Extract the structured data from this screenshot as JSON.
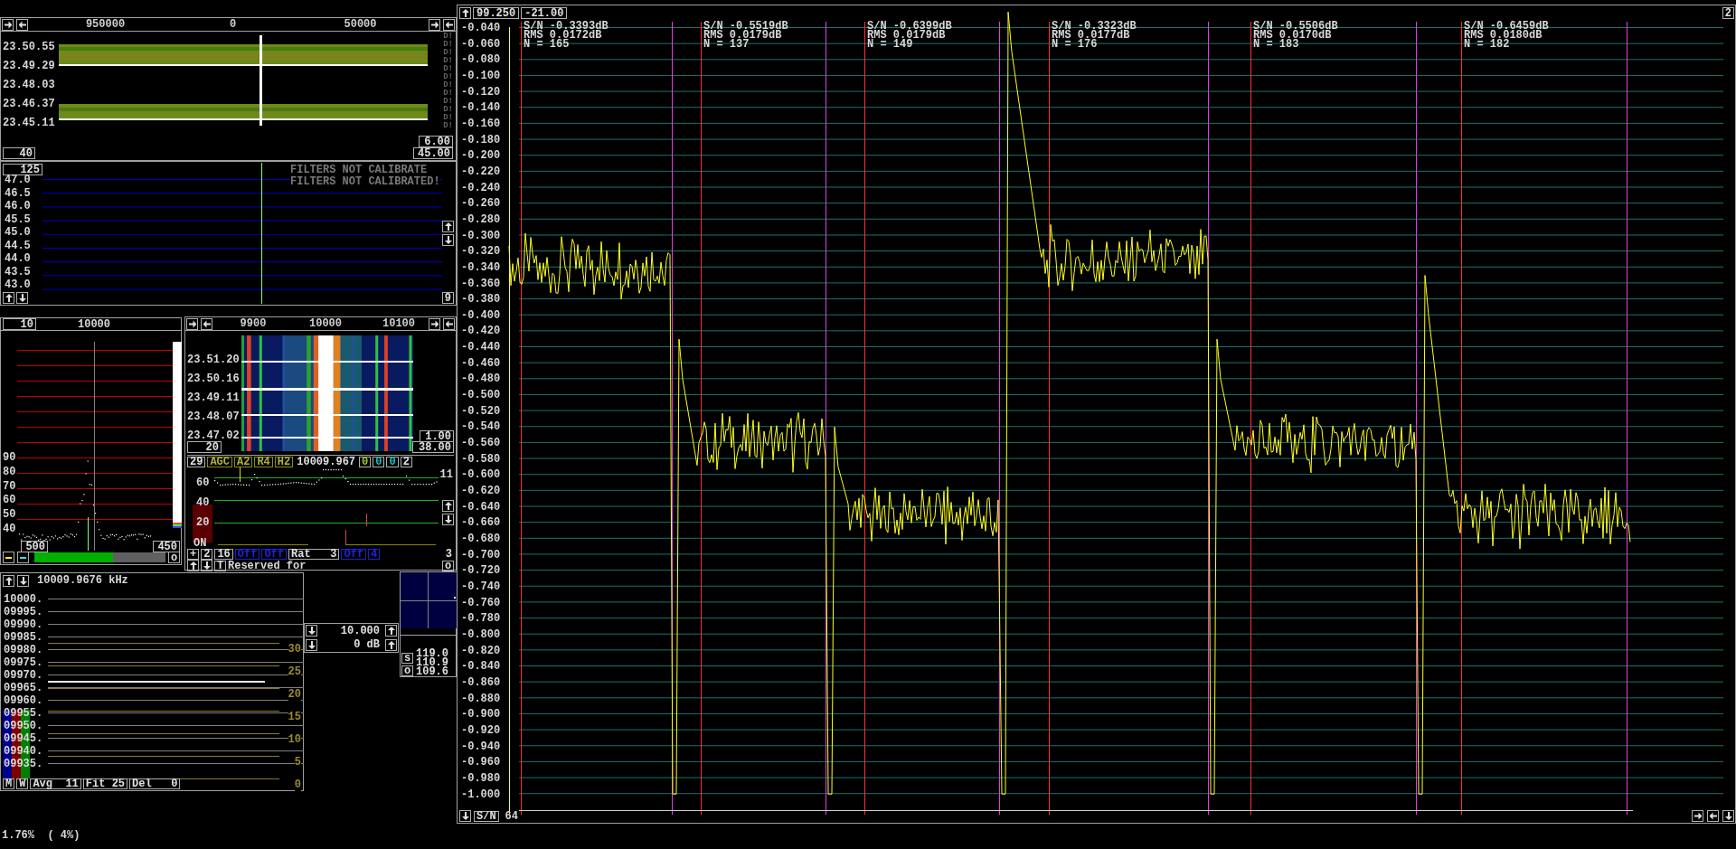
{
  "wide_waterfall": {
    "scale_labels": [
      "950000",
      "0",
      "50000"
    ],
    "time_labels": [
      "23.50.55",
      "23.49.29",
      "23.48.03",
      "23.46.37",
      "23.45.11"
    ],
    "side_marks": [
      "D!",
      "D!",
      "D!",
      "D!",
      "D!",
      "D!",
      "D!",
      "D!",
      "D!",
      "D!",
      "D!",
      "D!"
    ],
    "fields": [
      "40",
      "6.00",
      "45.00"
    ]
  },
  "baseband_graph": {
    "field": "125",
    "warnings": [
      "FILTERS NOT CALIBRATE",
      "FILTERS NOT CALIBRATED!"
    ],
    "y_labels": [
      "47.0",
      "46.5",
      "46.0",
      "45.5",
      "45.0",
      "44.5",
      "44.0",
      "43.5",
      "43.0"
    ],
    "counter": "9"
  },
  "af_graph": {
    "field": "10",
    "scale_label": "10000",
    "y_labels": [
      "90",
      "80",
      "70",
      "60",
      "50",
      "40"
    ],
    "fields": [
      "500",
      "450"
    ],
    "button": "o",
    "level": 0.6
  },
  "baseband_waterfall": {
    "scale_labels": [
      "9900",
      "10000",
      "10100"
    ],
    "time_labels": [
      "23.51.20",
      "23.50.16",
      "23.49.11",
      "23.48.07",
      "23.47.02"
    ],
    "fields": [
      "20",
      "1.00",
      "38.00"
    ]
  },
  "baseband_controls": {
    "status_row": [
      {
        "text": "29",
        "kind": "field"
      },
      {
        "text": "AGC",
        "kind": "toggle"
      },
      {
        "text": "A2",
        "kind": "toggle"
      },
      {
        "text": "R4",
        "kind": "toggle"
      },
      {
        "text": "H2",
        "kind": "toggle"
      },
      {
        "text": "10009.967",
        "kind": "freq"
      },
      {
        "text": "0",
        "kind": "level"
      },
      {
        "text": "0",
        "kind": "flag"
      },
      {
        "text": "0",
        "kind": "flag"
      },
      {
        "text": "2",
        "kind": "field"
      }
    ],
    "corner_label": "11",
    "y_labels": [
      "60",
      "40",
      "20"
    ],
    "on_label": "ON",
    "bottom_row": [
      {
        "text": "+",
        "kind": "field"
      },
      {
        "text": "2",
        "kind": "field"
      },
      {
        "text": "16",
        "kind": "field"
      },
      {
        "text": "Off",
        "kind": "off"
      },
      {
        "text": "Off",
        "kind": "off"
      },
      {
        "text": "Rat   3",
        "kind": "field"
      },
      {
        "text": "Off",
        "kind": "off"
      },
      {
        "text": "4",
        "kind": "off"
      },
      {
        "text": "3",
        "kind": "label"
      }
    ],
    "t_button": "T",
    "note": "Reserved for",
    "o_button": "o"
  },
  "freq_list": {
    "header": "10009.9676 kHz",
    "freq_labels": [
      "10000.",
      "09995.",
      "09990.",
      "09985.",
      "09980.",
      "09975.",
      "09970.",
      "09965.",
      "09960.",
      "09955.",
      "09950.",
      "09945.",
      "09940.",
      "09935."
    ],
    "scale_labels": [
      "30",
      "25",
      "20",
      "15",
      "10",
      "5",
      "0"
    ],
    "buttons": [
      "M",
      "W",
      "Avg  11",
      "Fit 25",
      "Del   0"
    ]
  },
  "gain": {
    "rows": [
      "10.000",
      "0 dB"
    ]
  },
  "meter": {
    "buttons": [
      "s",
      "o"
    ],
    "values": [
      "119.0",
      "110.9",
      "109.6"
    ]
  },
  "status": "1.76%  ( 4%)",
  "sn_chart": {
    "top_fields": [
      "99.250",
      "-21.00"
    ],
    "corner": "2",
    "y_labels": [
      "-0.040",
      "-0.060",
      "-0.080",
      "-0.100",
      "-0.120",
      "-0.140",
      "-0.160",
      "-0.180",
      "-0.200",
      "-0.220",
      "-0.240",
      "-0.260",
      "-0.280",
      "-0.300",
      "-0.320",
      "-0.340",
      "-0.360",
      "-0.380",
      "-0.400",
      "-0.420",
      "-0.440",
      "-0.460",
      "-0.480",
      "-0.500",
      "-0.520",
      "-0.540",
      "-0.560",
      "-0.580",
      "-0.600",
      "-0.620",
      "-0.640",
      "-0.660",
      "-0.680",
      "-0.700",
      "-0.720",
      "-0.740",
      "-0.760",
      "-0.780",
      "-0.800",
      "-0.820",
      "-0.840",
      "-0.860",
      "-0.880",
      "-0.900",
      "-0.920",
      "-0.940",
      "-0.960",
      "-0.980",
      "-1.000"
    ],
    "segments": [
      {
        "sn": "S/N -0.3393dB",
        "rms": "RMS 0.0172dB",
        "n": "N = 165"
      },
      {
        "sn": "S/N -0.5519dB",
        "rms": "RMS 0.0179dB",
        "n": "N = 137"
      },
      {
        "sn": "S/N -0.6399dB",
        "rms": "RMS 0.0179dB",
        "n": "N = 149"
      },
      {
        "sn": "S/N -0.3323dB",
        "rms": "RMS 0.0177dB",
        "n": "N = 176"
      },
      {
        "sn": "S/N -0.5506dB",
        "rms": "RMS 0.0170dB",
        "n": "N = 183"
      },
      {
        "sn": "S/N -0.6459dB",
        "rms": "RMS 0.0180dB",
        "n": "N = 182"
      }
    ],
    "mode_button": "S/N",
    "count": "64"
  }
}
